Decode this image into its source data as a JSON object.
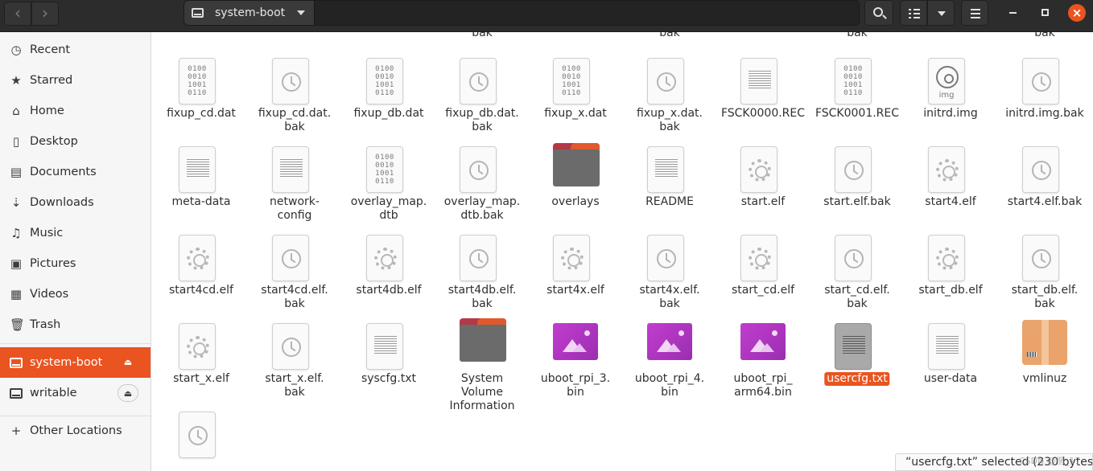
{
  "header": {
    "location": "system-boot"
  },
  "sidebar": {
    "places": [
      {
        "label": "Recent",
        "icon": "clock-icon"
      },
      {
        "label": "Starred",
        "icon": "star-icon"
      },
      {
        "label": "Home",
        "icon": "home-icon"
      },
      {
        "label": "Desktop",
        "icon": "desktop-icon"
      },
      {
        "label": "Documents",
        "icon": "documents-icon"
      },
      {
        "label": "Downloads",
        "icon": "downloads-icon"
      },
      {
        "label": "Music",
        "icon": "music-icon"
      },
      {
        "label": "Pictures",
        "icon": "pictures-icon"
      },
      {
        "label": "Videos",
        "icon": "videos-icon"
      },
      {
        "label": "Trash",
        "icon": "trash-icon"
      }
    ],
    "devices": [
      {
        "label": "system-boot",
        "active": true
      },
      {
        "label": "writable",
        "active": false
      }
    ],
    "other": "Other Locations"
  },
  "partial_row": [
    "bak",
    "bak",
    "bak",
    "bak",
    "bak"
  ],
  "files": [
    {
      "name": "fixup_cd.dat",
      "kind": "binary"
    },
    {
      "name": "fixup_cd.dat.\nbak",
      "kind": "backup"
    },
    {
      "name": "fixup_db.dat",
      "kind": "binary"
    },
    {
      "name": "fixup_db.dat.\nbak",
      "kind": "backup"
    },
    {
      "name": "fixup_x.dat",
      "kind": "binary"
    },
    {
      "name": "fixup_x.dat.\nbak",
      "kind": "backup"
    },
    {
      "name": "FSCK0000.REC",
      "kind": "text"
    },
    {
      "name": "FSCK0001.REC",
      "kind": "binary"
    },
    {
      "name": "initrd.img",
      "kind": "disc"
    },
    {
      "name": "initrd.img.bak",
      "kind": "backup"
    },
    {
      "name": "meta-data",
      "kind": "text"
    },
    {
      "name": "network-\nconfig",
      "kind": "text"
    },
    {
      "name": "overlay_map.\ndtb",
      "kind": "binary"
    },
    {
      "name": "overlay_map.\ndtb.bak",
      "kind": "backup"
    },
    {
      "name": "overlays",
      "kind": "folder"
    },
    {
      "name": "README",
      "kind": "text"
    },
    {
      "name": "start.elf",
      "kind": "exec"
    },
    {
      "name": "start.elf.bak",
      "kind": "backup"
    },
    {
      "name": "start4.elf",
      "kind": "exec"
    },
    {
      "name": "start4.elf.bak",
      "kind": "backup"
    },
    {
      "name": "start4cd.elf",
      "kind": "exec"
    },
    {
      "name": "start4cd.elf.\nbak",
      "kind": "backup"
    },
    {
      "name": "start4db.elf",
      "kind": "exec"
    },
    {
      "name": "start4db.elf.\nbak",
      "kind": "backup"
    },
    {
      "name": "start4x.elf",
      "kind": "exec"
    },
    {
      "name": "start4x.elf.\nbak",
      "kind": "backup"
    },
    {
      "name": "start_cd.elf",
      "kind": "exec"
    },
    {
      "name": "start_cd.elf.\nbak",
      "kind": "backup"
    },
    {
      "name": "start_db.elf",
      "kind": "exec"
    },
    {
      "name": "start_db.elf.\nbak",
      "kind": "backup"
    },
    {
      "name": "start_x.elf",
      "kind": "exec"
    },
    {
      "name": "start_x.elf.\nbak",
      "kind": "backup"
    },
    {
      "name": "syscfg.txt",
      "kind": "text"
    },
    {
      "name": "System\nVolume\nInformation",
      "kind": "folder"
    },
    {
      "name": "uboot_rpi_3.\nbin",
      "kind": "image"
    },
    {
      "name": "uboot_rpi_4.\nbin",
      "kind": "image"
    },
    {
      "name": "uboot_rpi_\narm64.bin",
      "kind": "image"
    },
    {
      "name": "usercfg.txt",
      "kind": "text",
      "selected": true
    },
    {
      "name": "user-data",
      "kind": "text"
    },
    {
      "name": "vmlinuz",
      "kind": "package"
    },
    {
      "name": "",
      "kind": "backup"
    }
  ],
  "binary_glyph": "0100\n0010\n1001\n0110",
  "disc_label": "img",
  "status": "“usercfg.txt” selected (230 bytes)",
  "watermark": "CSDN @楷_17",
  "colors": {
    "accent": "#e95420",
    "headerbar": "#2c2c2c",
    "sidebar": "#f6f6f6"
  }
}
